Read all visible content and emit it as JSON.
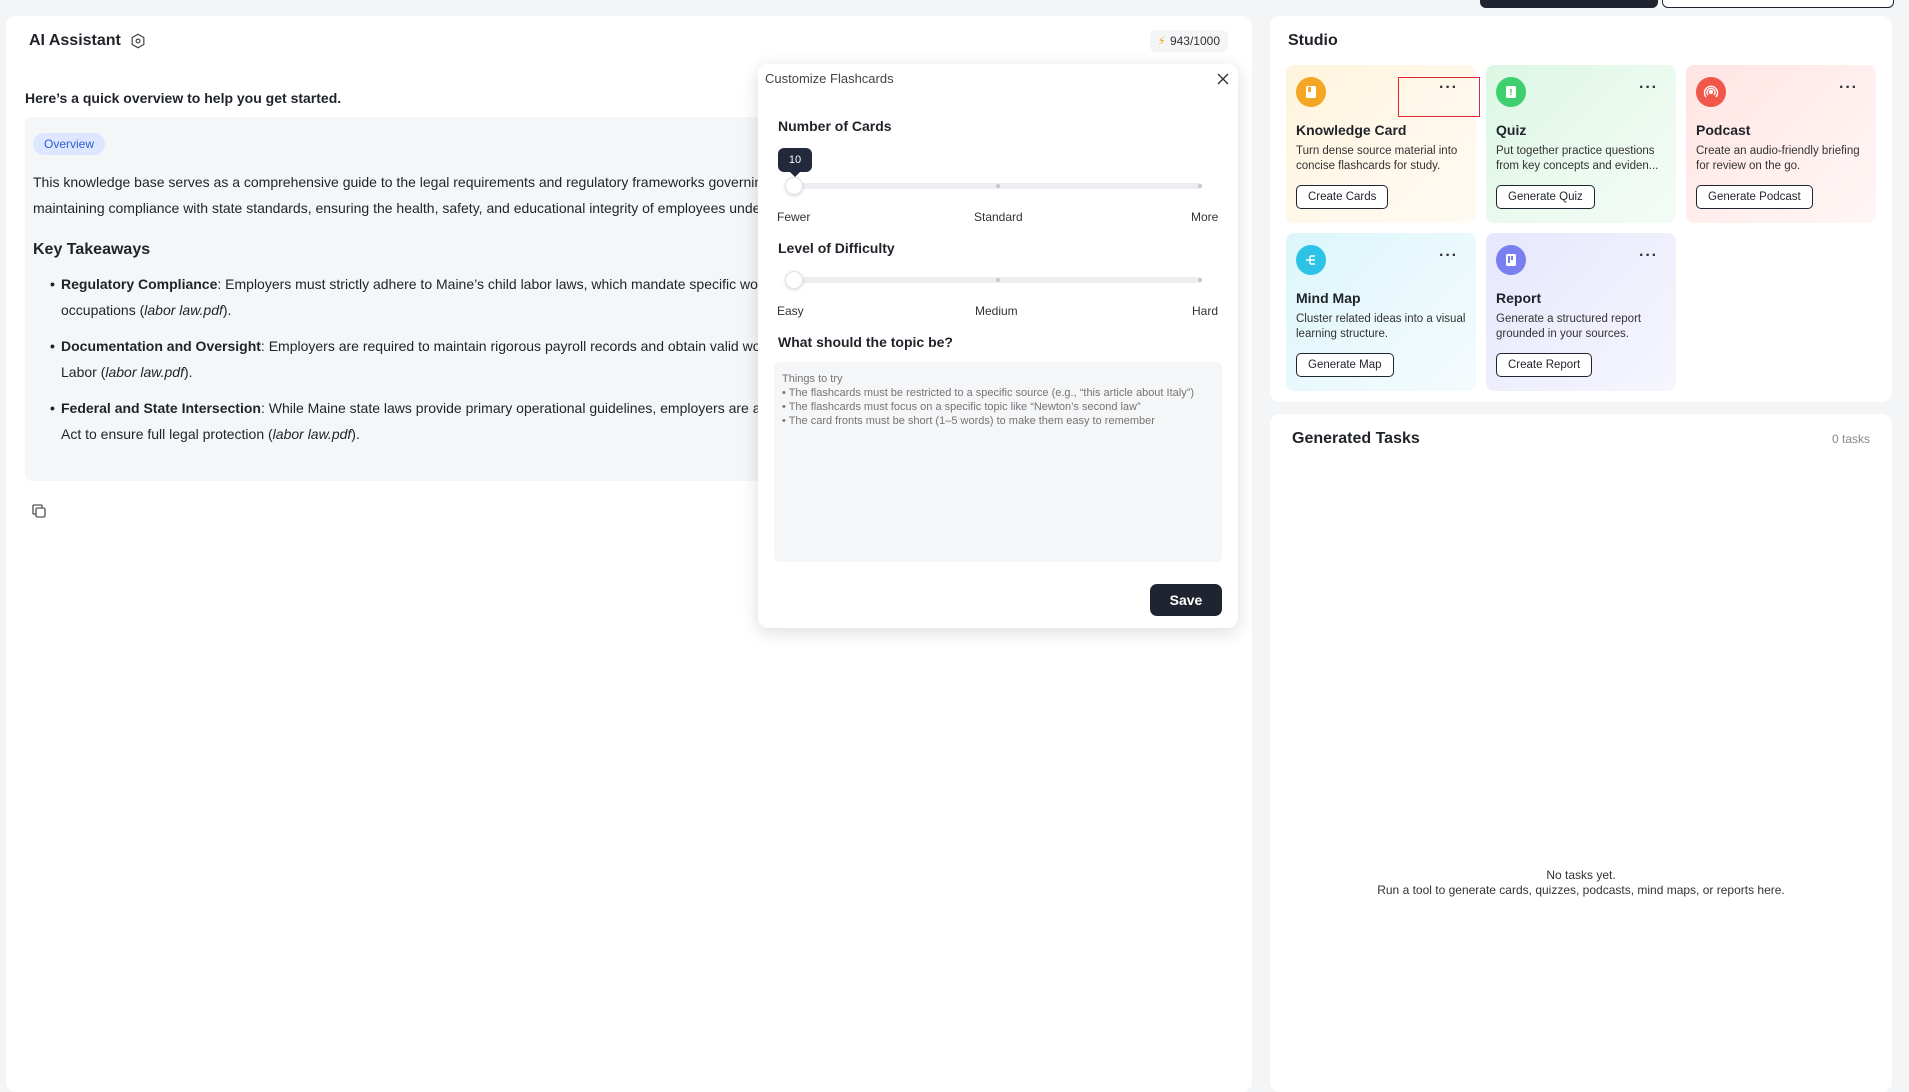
{
  "ai_assistant": {
    "title": "AI Assistant",
    "credits": "943/1000",
    "overview_heading": "Here’s a quick overview to help you get started.",
    "badge": "Overview",
    "intro_line1": "This knowledge base serves as a comprehensive guide to the legal requirements and regulatory frameworks governing",
    "intro_line2": "maintaining compliance with state standards, ensuring the health, safety, and educational integrity of employees under",
    "key_takeaways_heading": "Key Takeaways",
    "takeaways": [
      {
        "title": "Regulatory Compliance",
        "line1": ": Employers must strictly adhere to Maine’s child labor laws, which mandate specific workp",
        "line2_pre": "occupations (",
        "source": "labor law.pdf",
        "line2_post": ")."
      },
      {
        "title": "Documentation and Oversight",
        "line1": ": Employers are required to maintain rigorous payroll records and obtain valid work",
        "line2_pre": "Labor (",
        "source": "labor law.pdf",
        "line2_post": ")."
      },
      {
        "title": "Federal and State Intersection",
        "line1": ": While Maine state laws provide primary operational guidelines, employers are advis",
        "line2_pre": "Act to ensure full legal protection (",
        "source": "labor law.pdf",
        "line2_post": ")."
      }
    ]
  },
  "modal": {
    "title": "Customize Flashcards",
    "number_of_cards_label": "Number of Cards",
    "cards_value": "10",
    "cards_scale": [
      "Fewer",
      "Standard",
      "More"
    ],
    "difficulty_label": "Level of Difficulty",
    "difficulty_scale": [
      "Easy",
      "Medium",
      "Hard"
    ],
    "topic_label": "What should the topic be?",
    "topic_placeholder": "Things to try\n• The flashcards must be restricted to a specific source (e.g., “this article about Italy”)\n• The flashcards must focus on a specific topic like “Newton’s second law”\n• The card fronts must be short (1–5 words) to make them easy to remember",
    "save_label": "Save"
  },
  "studio": {
    "title": "Studio",
    "cards": [
      {
        "title": "Knowledge Card",
        "desc": "Turn dense source material into concise flashcards for study.",
        "button": "Create Cards",
        "icon": "book-icon",
        "color": "#f5a623"
      },
      {
        "title": "Quiz",
        "desc": "Put together practice questions from key concepts and eviden...",
        "button": "Generate Quiz",
        "icon": "quiz-icon",
        "color": "#3ecf6e"
      },
      {
        "title": "Podcast",
        "desc": "Create an audio-friendly briefing for review on the go.",
        "button": "Generate Podcast",
        "icon": "podcast-icon",
        "color": "#f0564a"
      },
      {
        "title": "Mind Map",
        "desc": "Cluster related ideas into a visual learning structure.",
        "button": "Generate Map",
        "icon": "mindmap-icon",
        "color": "#2cc3e6"
      },
      {
        "title": "Report",
        "desc": "Generate a structured report grounded in your sources.",
        "button": "Create Report",
        "icon": "report-icon",
        "color": "#7a7ff0"
      }
    ]
  },
  "tasks": {
    "title": "Generated Tasks",
    "count": "0 tasks",
    "empty_line1": "No tasks yet.",
    "empty_line2": "Run a tool to generate cards, quizzes, podcasts, mind maps, or reports here."
  }
}
